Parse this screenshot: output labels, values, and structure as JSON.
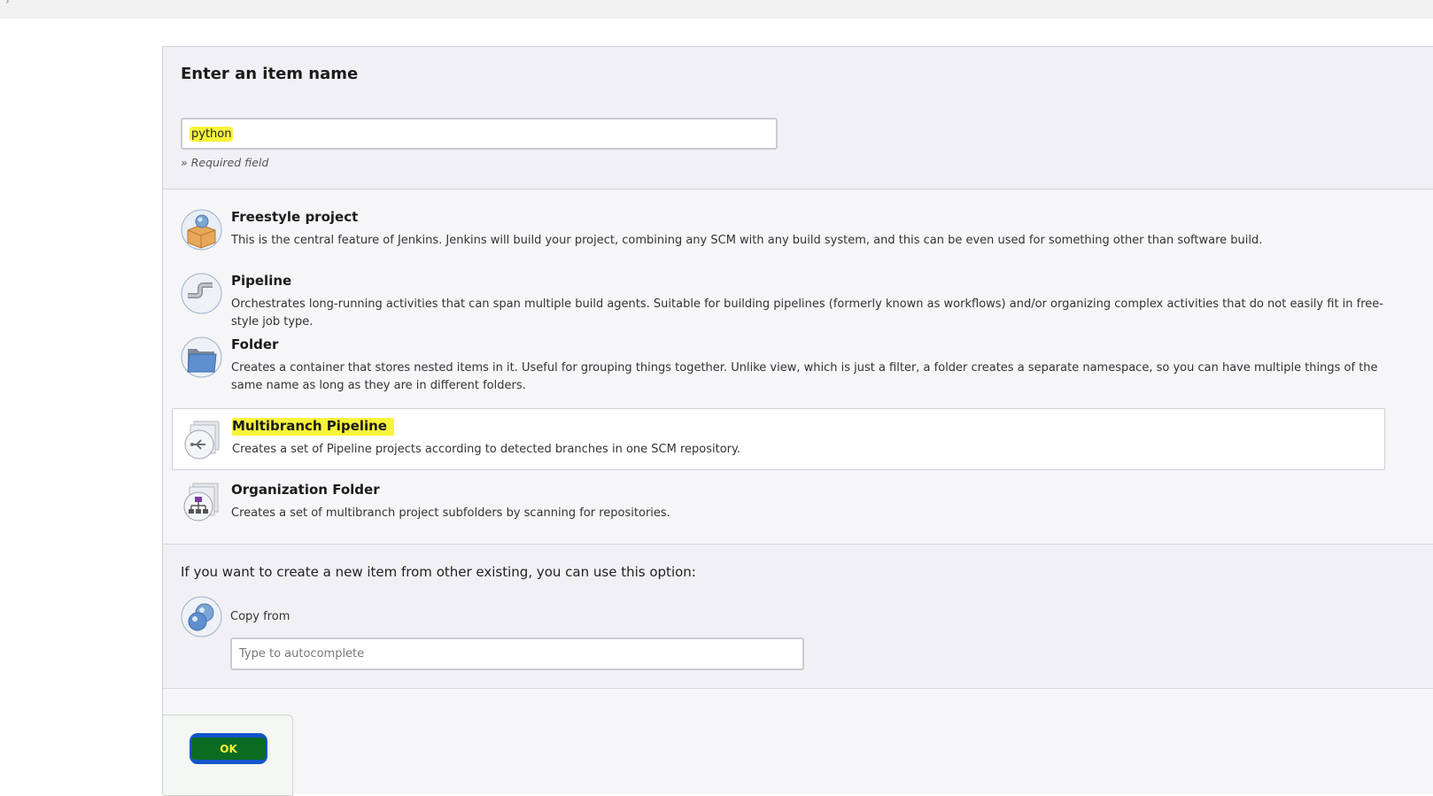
{
  "form": {
    "heading": "Enter an item name",
    "item_name_value": "python",
    "required_hint": "» Required field"
  },
  "item_types": [
    {
      "name": "Freestyle project",
      "icon": "freestyle-project-icon",
      "description": "This is the central feature of Jenkins. Jenkins will build your project, combining any SCM with any build system, and this can be even used for something other than software build.",
      "selected": false
    },
    {
      "name": "Pipeline",
      "icon": "pipeline-icon",
      "description": "Orchestrates long-running activities that can span multiple build agents. Suitable for building pipelines (formerly known as workflows) and/or organizing complex activities that do not easily fit in free-style job type.",
      "selected": false
    },
    {
      "name": "Folder",
      "icon": "folder-icon",
      "description": "Creates a container that stores nested items in it. Useful for grouping things together. Unlike view, which is just a filter, a folder creates a separate namespace, so you can have multiple things of the same name as long as they are in different folders.",
      "selected": false
    },
    {
      "name": "Multibranch Pipeline",
      "icon": "multibranch-pipeline-icon",
      "description": "Creates a set of Pipeline projects according to detected branches in one SCM repository.",
      "selected": true
    },
    {
      "name": "Organization Folder",
      "icon": "organization-folder-icon",
      "description": "Creates a set of multibranch project subfolders by scanning for repositories.",
      "selected": false
    }
  ],
  "copy": {
    "prompt": "If you want to create a new item from other existing, you can use this option:",
    "label": "Copy from",
    "placeholder": "Type to autocomplete",
    "icon": "copy-from-icon"
  },
  "submit": {
    "label": "OK"
  },
  "colors": {
    "highlight": "#f7f43a",
    "ok_button_outer": "#1156c9",
    "ok_button_inner": "#0b6b21"
  }
}
